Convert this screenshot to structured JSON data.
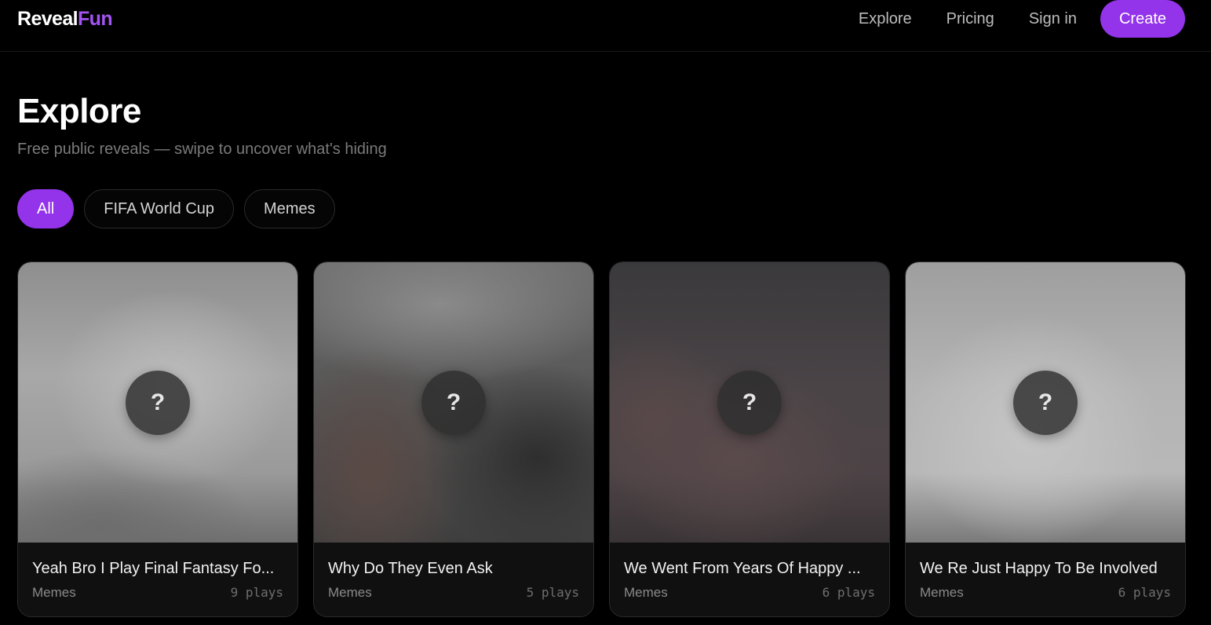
{
  "brand": {
    "name_main": "Reveal",
    "name_accent": "Fun",
    "accent_color": "#a454f2"
  },
  "nav": {
    "links": [
      "Explore",
      "Pricing",
      "Sign in"
    ],
    "create_label": "Create",
    "create_color": "#9333ea"
  },
  "header": {
    "title": "Explore",
    "subtitle": "Free public reveals — swipe to uncover what's hiding"
  },
  "filters": {
    "items": [
      "All",
      "FIFA World Cup",
      "Memes"
    ],
    "active": "All"
  },
  "cards": [
    {
      "title": "Yeah Bro I Play Final Fantasy Fo...",
      "category": "Memes",
      "plays": "9 plays",
      "icon": "question-mark-icon",
      "badge": "?"
    },
    {
      "title": "Why Do They Even Ask",
      "category": "Memes",
      "plays": "5 plays",
      "icon": "question-mark-icon",
      "badge": "?"
    },
    {
      "title": "We Went From Years Of Happy ...",
      "category": "Memes",
      "plays": "6 plays",
      "icon": "question-mark-icon",
      "badge": "?"
    },
    {
      "title": "We Re Just Happy To Be Involved",
      "category": "Memes",
      "plays": "6 plays",
      "icon": "question-mark-icon",
      "badge": "?"
    }
  ]
}
